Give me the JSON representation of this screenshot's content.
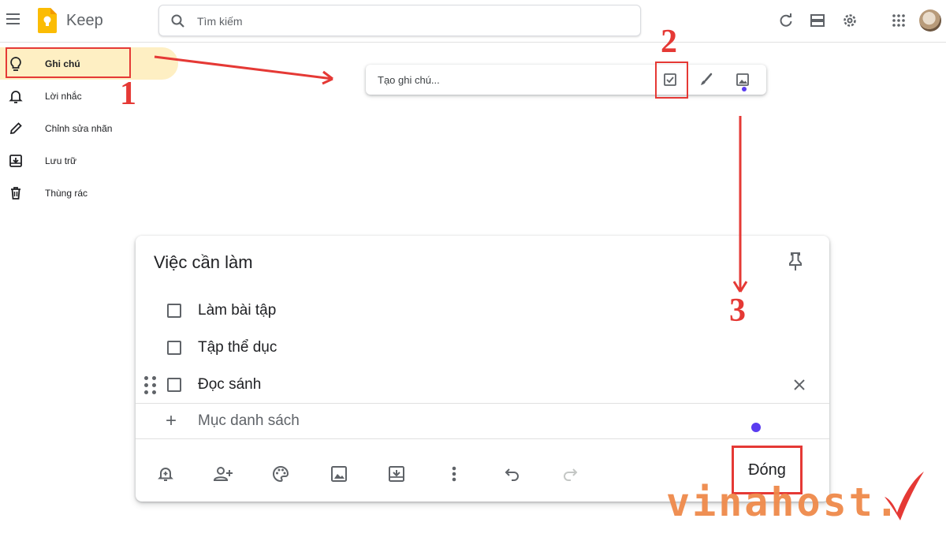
{
  "header": {
    "app_title": "Keep",
    "search_placeholder": "Tìm kiếm"
  },
  "sidebar": {
    "items": [
      {
        "label": "Ghi chú",
        "icon": "lightbulb-icon",
        "active": true
      },
      {
        "label": "Lời nhắc",
        "icon": "bell-icon"
      },
      {
        "label": "Chỉnh sửa nhãn",
        "icon": "pencil-icon"
      },
      {
        "label": "Lưu trữ",
        "icon": "archive-icon"
      },
      {
        "label": "Thùng rác",
        "icon": "trash-icon"
      }
    ]
  },
  "take_note": {
    "placeholder": "Tạo ghi chú..."
  },
  "editor": {
    "title": "Việc cần làm",
    "items": [
      "Làm bài tập",
      "Tập thể dục",
      "Đọc sánh"
    ],
    "add_item_label": "Mục danh sách",
    "close_label": "Đóng"
  },
  "annotations": {
    "step1": "1",
    "step2": "2",
    "step3": "3",
    "color": "#e53935"
  },
  "watermark": {
    "text": "vinahost."
  },
  "colors": {
    "keep_yellow": "#fbbc04",
    "active_bg": "#feefc3",
    "accent_dot": "#5a3cf0",
    "watermark": "#ef8a4a"
  }
}
